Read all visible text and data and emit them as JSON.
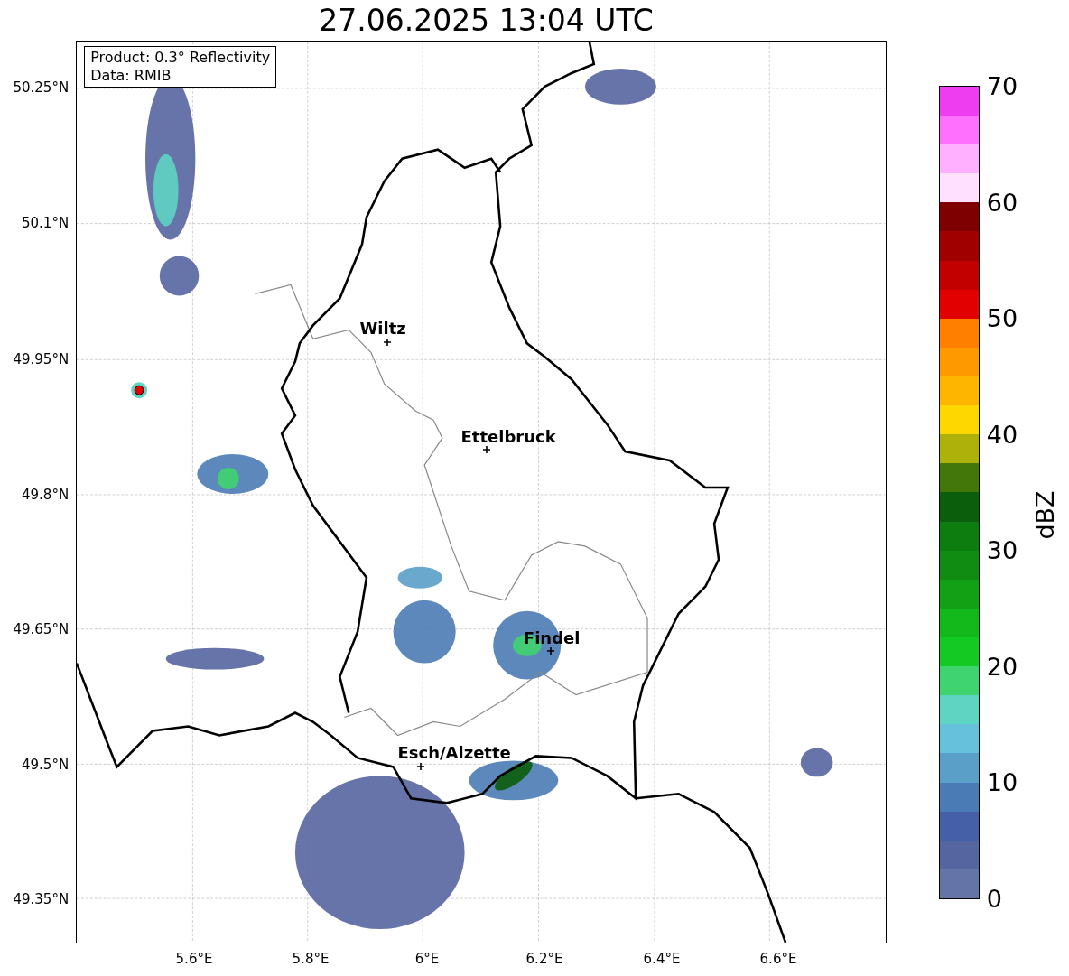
{
  "title": "27.06.2025 13:04 UTC",
  "map": {
    "info_box": [
      "Product: 0.3° Reflectivity",
      "Data: RMIB"
    ],
    "y_ticks": [
      "50.25°N",
      "50.1°N",
      "49.95°N",
      "49.8°N",
      "49.65°N",
      "49.5°N",
      "49.35°N"
    ],
    "x_ticks": [
      "5.6°E",
      "5.8°E",
      "6°E",
      "6.2°E",
      "6.4°E",
      "6.6°E"
    ],
    "places": [
      {
        "name": "Wiltz"
      },
      {
        "name": "Ettelbruck"
      },
      {
        "name": "Findel"
      },
      {
        "name": "Esch/Alzette"
      }
    ]
  },
  "colorbar": {
    "label": "dBZ",
    "ticks": [
      "70",
      "60",
      "50",
      "40",
      "30",
      "20",
      "10",
      "0"
    ],
    "bins": [
      {
        "color": "#6474a7"
      },
      {
        "color": "#5565a0"
      },
      {
        "color": "#4560a6"
      },
      {
        "color": "#4a7bb4"
      },
      {
        "color": "#5a9fc8"
      },
      {
        "color": "#66c2dc"
      },
      {
        "color": "#5fd4c3"
      },
      {
        "color": "#3fd46f"
      },
      {
        "color": "#14c922"
      },
      {
        "color": "#13b81b"
      },
      {
        "color": "#12a115"
      },
      {
        "color": "#108c12"
      },
      {
        "color": "#0e7d10"
      },
      {
        "color": "#0b5e0b"
      },
      {
        "color": "#437709"
      },
      {
        "color": "#adb10a"
      },
      {
        "color": "#ffd700"
      },
      {
        "color": "#fdb500"
      },
      {
        "color": "#fe9a00"
      },
      {
        "color": "#ff7f00"
      },
      {
        "color": "#e30000"
      },
      {
        "color": "#c20000"
      },
      {
        "color": "#a00000"
      },
      {
        "color": "#7e0000"
      },
      {
        "color": "#ffe0ff"
      },
      {
        "color": "#ffb0ff"
      },
      {
        "color": "#ff70ff"
      },
      {
        "color": "#ee3cf0"
      }
    ]
  }
}
